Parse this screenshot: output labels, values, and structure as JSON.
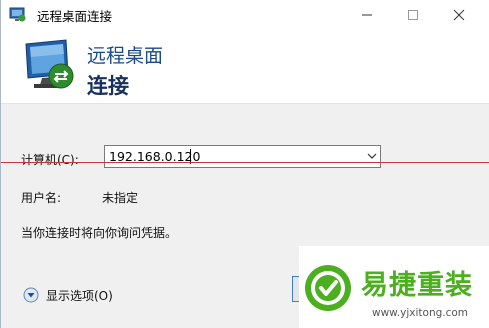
{
  "window": {
    "title": "远程桌面连接"
  },
  "header": {
    "line1": "远程桌面",
    "line2": "连接"
  },
  "form": {
    "computer_label": "计算机(C):",
    "computer_value": "192.168.0.120",
    "user_label": "用户名:",
    "user_value": "未指定",
    "credentials_note": "当你连接时将向你询问凭据。"
  },
  "footer": {
    "show_options_label": "显示选项(O)"
  },
  "watermark": {
    "title": "易捷重装",
    "url": "www.yjxitong.com"
  },
  "colors": {
    "header_title": "#1b4a8a",
    "header_bold": "#17305f",
    "watermark_green": "#4caf20",
    "annotation_line": "#c23a3a"
  },
  "icons": {
    "title": "remote-desktop-icon",
    "header": "remote-desktop-monitor-icon",
    "options": "chevron-down-circle-icon"
  }
}
